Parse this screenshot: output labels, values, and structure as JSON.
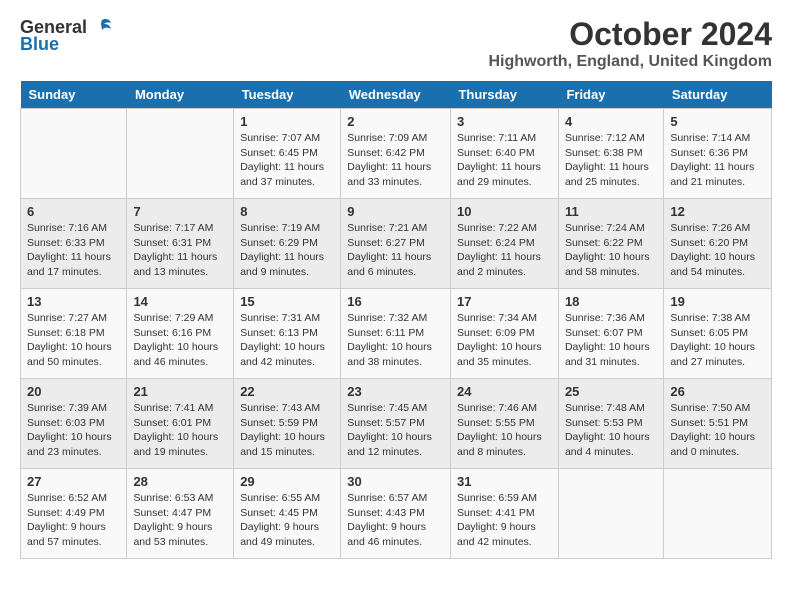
{
  "header": {
    "logo_general": "General",
    "logo_blue": "Blue",
    "month": "October 2024",
    "location": "Highworth, England, United Kingdom"
  },
  "days_of_week": [
    "Sunday",
    "Monday",
    "Tuesday",
    "Wednesday",
    "Thursday",
    "Friday",
    "Saturday"
  ],
  "weeks": [
    [
      {
        "day": "",
        "info": ""
      },
      {
        "day": "",
        "info": ""
      },
      {
        "day": "1",
        "info": "Sunrise: 7:07 AM\nSunset: 6:45 PM\nDaylight: 11 hours and 37 minutes."
      },
      {
        "day": "2",
        "info": "Sunrise: 7:09 AM\nSunset: 6:42 PM\nDaylight: 11 hours and 33 minutes."
      },
      {
        "day": "3",
        "info": "Sunrise: 7:11 AM\nSunset: 6:40 PM\nDaylight: 11 hours and 29 minutes."
      },
      {
        "day": "4",
        "info": "Sunrise: 7:12 AM\nSunset: 6:38 PM\nDaylight: 11 hours and 25 minutes."
      },
      {
        "day": "5",
        "info": "Sunrise: 7:14 AM\nSunset: 6:36 PM\nDaylight: 11 hours and 21 minutes."
      }
    ],
    [
      {
        "day": "6",
        "info": "Sunrise: 7:16 AM\nSunset: 6:33 PM\nDaylight: 11 hours and 17 minutes."
      },
      {
        "day": "7",
        "info": "Sunrise: 7:17 AM\nSunset: 6:31 PM\nDaylight: 11 hours and 13 minutes."
      },
      {
        "day": "8",
        "info": "Sunrise: 7:19 AM\nSunset: 6:29 PM\nDaylight: 11 hours and 9 minutes."
      },
      {
        "day": "9",
        "info": "Sunrise: 7:21 AM\nSunset: 6:27 PM\nDaylight: 11 hours and 6 minutes."
      },
      {
        "day": "10",
        "info": "Sunrise: 7:22 AM\nSunset: 6:24 PM\nDaylight: 11 hours and 2 minutes."
      },
      {
        "day": "11",
        "info": "Sunrise: 7:24 AM\nSunset: 6:22 PM\nDaylight: 10 hours and 58 minutes."
      },
      {
        "day": "12",
        "info": "Sunrise: 7:26 AM\nSunset: 6:20 PM\nDaylight: 10 hours and 54 minutes."
      }
    ],
    [
      {
        "day": "13",
        "info": "Sunrise: 7:27 AM\nSunset: 6:18 PM\nDaylight: 10 hours and 50 minutes."
      },
      {
        "day": "14",
        "info": "Sunrise: 7:29 AM\nSunset: 6:16 PM\nDaylight: 10 hours and 46 minutes."
      },
      {
        "day": "15",
        "info": "Sunrise: 7:31 AM\nSunset: 6:13 PM\nDaylight: 10 hours and 42 minutes."
      },
      {
        "day": "16",
        "info": "Sunrise: 7:32 AM\nSunset: 6:11 PM\nDaylight: 10 hours and 38 minutes."
      },
      {
        "day": "17",
        "info": "Sunrise: 7:34 AM\nSunset: 6:09 PM\nDaylight: 10 hours and 35 minutes."
      },
      {
        "day": "18",
        "info": "Sunrise: 7:36 AM\nSunset: 6:07 PM\nDaylight: 10 hours and 31 minutes."
      },
      {
        "day": "19",
        "info": "Sunrise: 7:38 AM\nSunset: 6:05 PM\nDaylight: 10 hours and 27 minutes."
      }
    ],
    [
      {
        "day": "20",
        "info": "Sunrise: 7:39 AM\nSunset: 6:03 PM\nDaylight: 10 hours and 23 minutes."
      },
      {
        "day": "21",
        "info": "Sunrise: 7:41 AM\nSunset: 6:01 PM\nDaylight: 10 hours and 19 minutes."
      },
      {
        "day": "22",
        "info": "Sunrise: 7:43 AM\nSunset: 5:59 PM\nDaylight: 10 hours and 15 minutes."
      },
      {
        "day": "23",
        "info": "Sunrise: 7:45 AM\nSunset: 5:57 PM\nDaylight: 10 hours and 12 minutes."
      },
      {
        "day": "24",
        "info": "Sunrise: 7:46 AM\nSunset: 5:55 PM\nDaylight: 10 hours and 8 minutes."
      },
      {
        "day": "25",
        "info": "Sunrise: 7:48 AM\nSunset: 5:53 PM\nDaylight: 10 hours and 4 minutes."
      },
      {
        "day": "26",
        "info": "Sunrise: 7:50 AM\nSunset: 5:51 PM\nDaylight: 10 hours and 0 minutes."
      }
    ],
    [
      {
        "day": "27",
        "info": "Sunrise: 6:52 AM\nSunset: 4:49 PM\nDaylight: 9 hours and 57 minutes."
      },
      {
        "day": "28",
        "info": "Sunrise: 6:53 AM\nSunset: 4:47 PM\nDaylight: 9 hours and 53 minutes."
      },
      {
        "day": "29",
        "info": "Sunrise: 6:55 AM\nSunset: 4:45 PM\nDaylight: 9 hours and 49 minutes."
      },
      {
        "day": "30",
        "info": "Sunrise: 6:57 AM\nSunset: 4:43 PM\nDaylight: 9 hours and 46 minutes."
      },
      {
        "day": "31",
        "info": "Sunrise: 6:59 AM\nSunset: 4:41 PM\nDaylight: 9 hours and 42 minutes."
      },
      {
        "day": "",
        "info": ""
      },
      {
        "day": "",
        "info": ""
      }
    ]
  ]
}
